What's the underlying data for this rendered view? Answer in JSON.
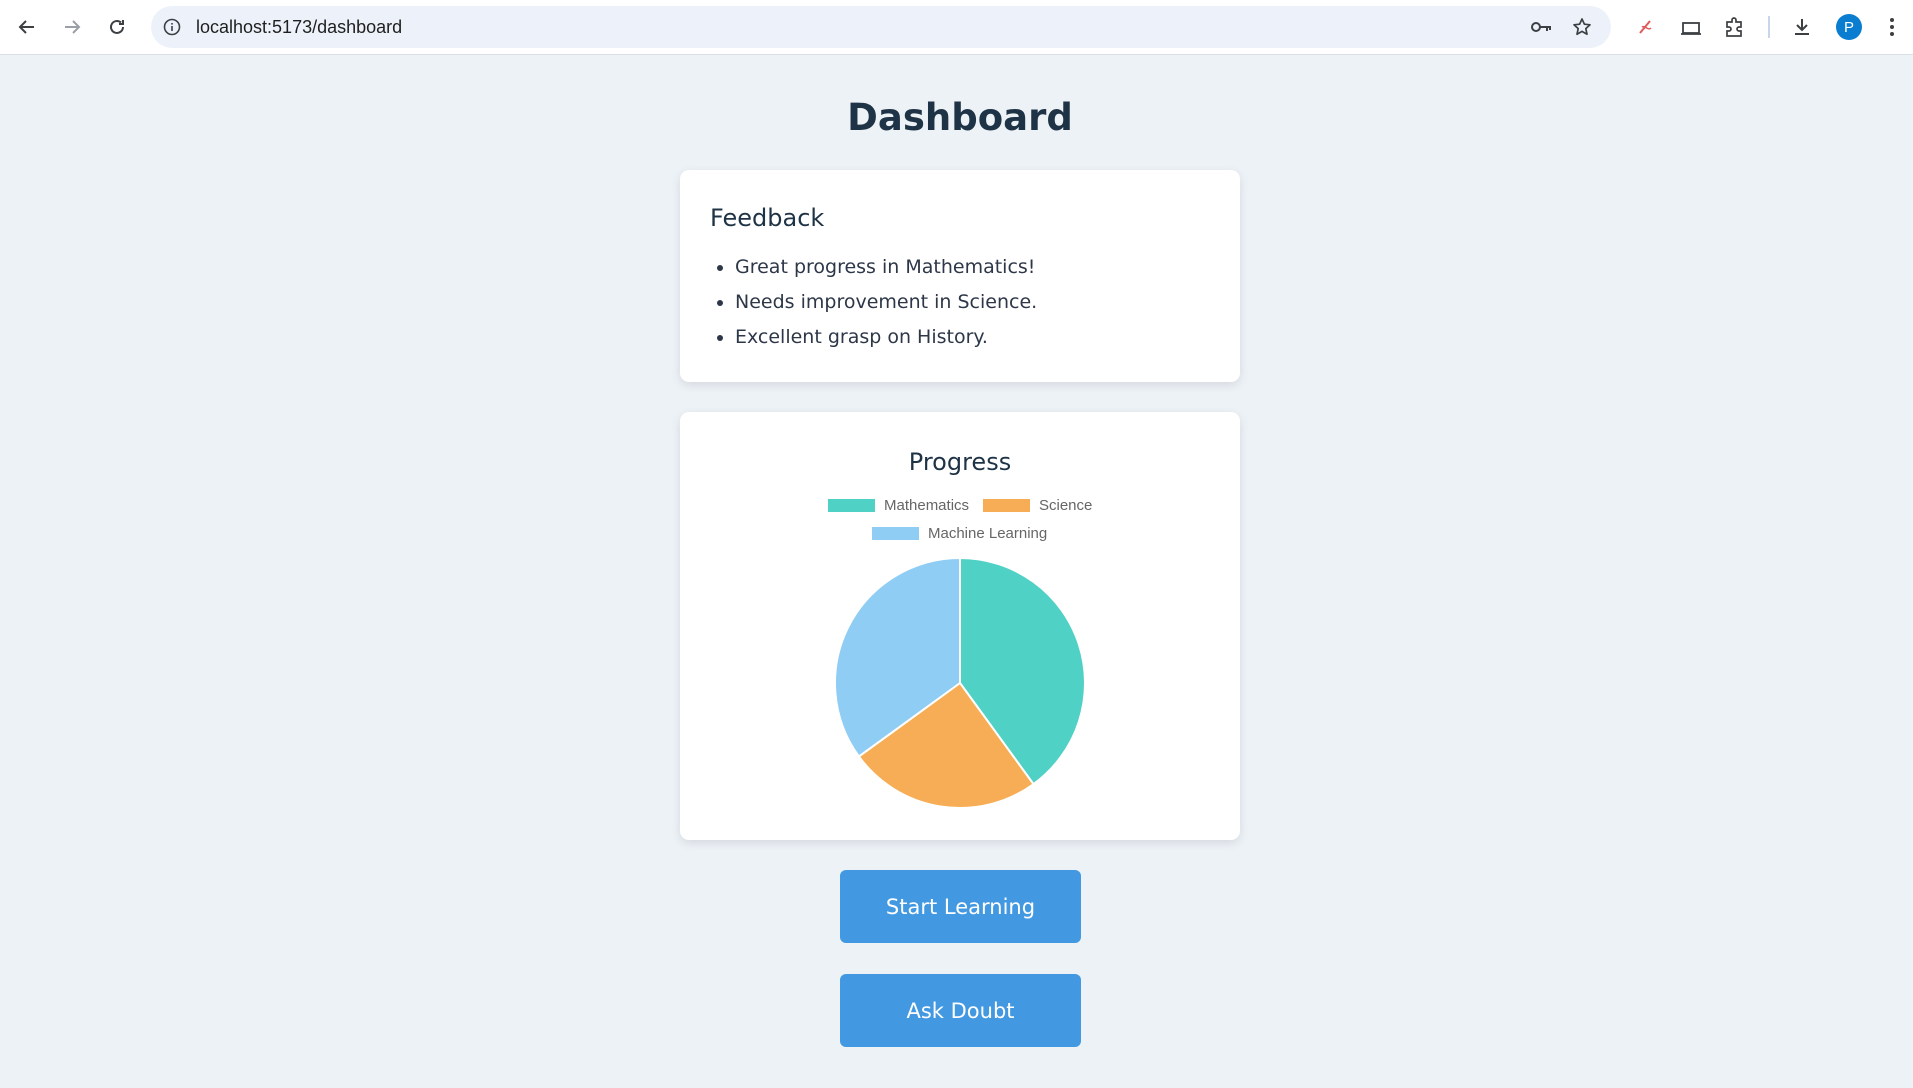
{
  "browser": {
    "url": "localhost:5173/dashboard",
    "profile_initial": "P"
  },
  "page": {
    "title": "Dashboard"
  },
  "feedback": {
    "heading": "Feedback",
    "items": [
      "Great progress in Mathematics!",
      "Needs improvement in Science.",
      "Excellent grasp on History."
    ]
  },
  "progress": {
    "heading": "Progress"
  },
  "chart_data": {
    "type": "pie",
    "title": "",
    "categories": [
      "Mathematics",
      "Science",
      "Machine Learning"
    ],
    "values": [
      40,
      25,
      35
    ],
    "colors": [
      "#4fd1c5",
      "#f6ad55",
      "#90cdf4"
    ],
    "legend_position": "top"
  },
  "actions": {
    "start_learning": "Start Learning",
    "ask_doubt": "Ask Doubt"
  }
}
